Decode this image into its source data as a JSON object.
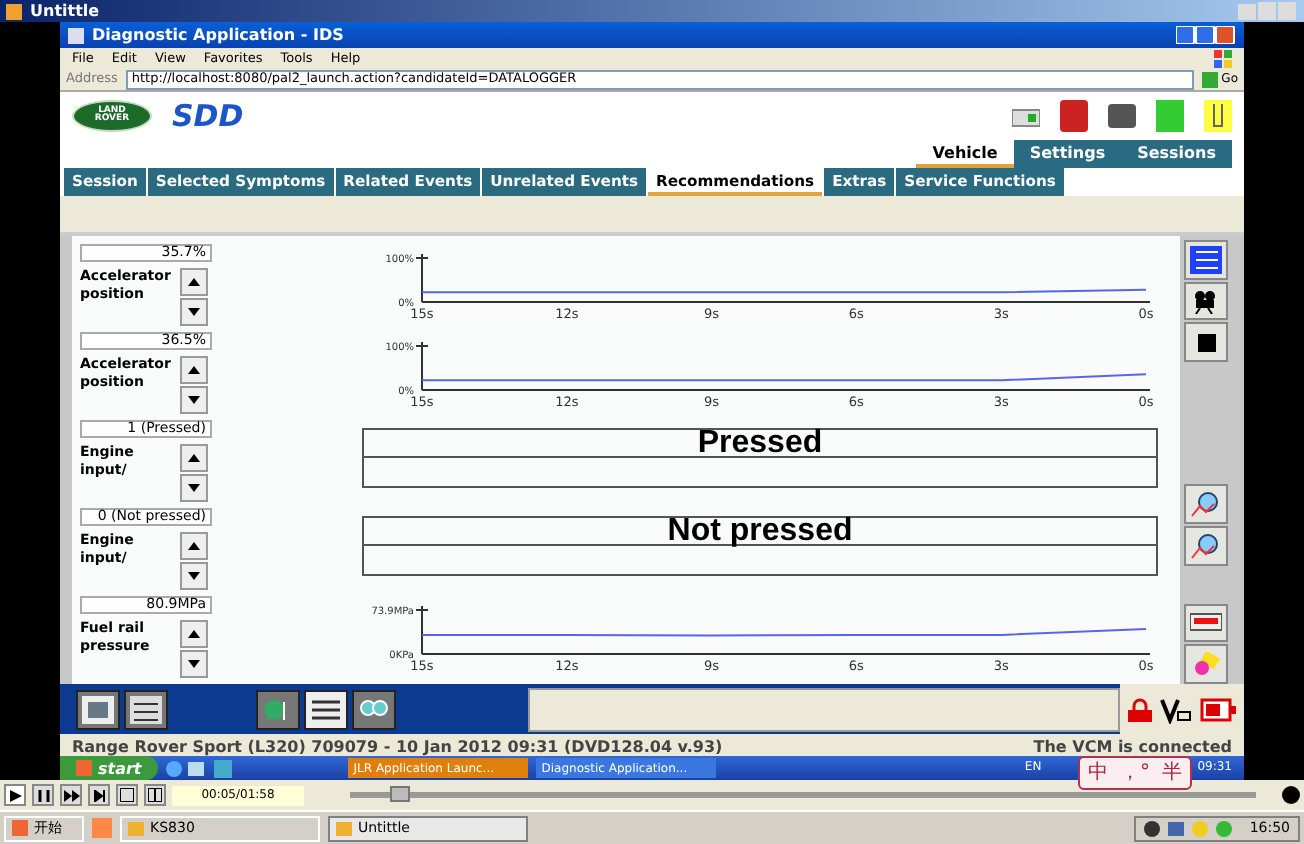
{
  "player_window": {
    "title": "Untittle"
  },
  "browser": {
    "title": "Diagnostic Application - IDS",
    "menu": [
      "File",
      "Edit",
      "View",
      "Favorites",
      "Tools",
      "Help"
    ],
    "address_label": "Address",
    "url": "http://localhost:8080/pal2_launch.action?candidateId=DATALOGGER",
    "go_button": "Go"
  },
  "app": {
    "logo_lines": [
      "LAND",
      "ROVER"
    ],
    "brand": "SDD",
    "top_tabs": [
      {
        "label": "Vehicle",
        "selected": true
      },
      {
        "label": "Settings",
        "selected": false
      },
      {
        "label": "Sessions",
        "selected": false
      }
    ],
    "tabs": [
      {
        "label": "Session",
        "selected": false
      },
      {
        "label": "Selected Symptoms",
        "selected": false
      },
      {
        "label": "Related Events",
        "selected": false
      },
      {
        "label": "Unrelated Events",
        "selected": false
      },
      {
        "label": "Recommendations",
        "selected": true
      },
      {
        "label": "Extras",
        "selected": false
      },
      {
        "label": "Service Functions",
        "selected": false
      }
    ],
    "signals": [
      {
        "kind": "graph",
        "value": "35.7%",
        "name": "Accelerator position",
        "chart_data": {
          "type": "line",
          "categories": [
            "15s",
            "12s",
            "9s",
            "6s",
            "3s",
            "0s"
          ],
          "ylim": [
            0,
            100
          ],
          "yticks": [
            {
              "value": 0,
              "label": "0%"
            },
            {
              "value": 100,
              "label": "100%"
            }
          ],
          "series": [
            {
              "color": "#5566ee",
              "values": [
                22,
                22,
                22,
                22,
                22,
                28
              ]
            }
          ]
        }
      },
      {
        "kind": "graph",
        "value": "36.5%",
        "name": "Accelerator position",
        "chart_data": {
          "type": "line",
          "categories": [
            "15s",
            "12s",
            "9s",
            "6s",
            "3s",
            "0s"
          ],
          "ylim": [
            0,
            100
          ],
          "yticks": [
            {
              "value": 0,
              "label": "0%"
            },
            {
              "value": 100,
              "label": "100%"
            }
          ],
          "series": [
            {
              "color": "#5566ee",
              "values": [
                22,
                22,
                22,
                22,
                22,
                36
              ]
            }
          ]
        }
      },
      {
        "kind": "state",
        "value": "1 (Pressed)",
        "name": "Engine input/",
        "state_text": "Pressed"
      },
      {
        "kind": "state",
        "value": "0 (Not pressed)",
        "name": "Engine input/",
        "state_text": "Not pressed"
      },
      {
        "kind": "graph",
        "value": "80.9MPa",
        "name": "Fuel rail pressure",
        "chart_data": {
          "type": "line",
          "categories": [
            "15s",
            "12s",
            "9s",
            "6s",
            "3s",
            "0s"
          ],
          "ylim": [
            0,
            73.9
          ],
          "yticks": [
            {
              "value": 0,
              "label": "0KPa"
            },
            {
              "value": 73.9,
              "label": "73.9MPa"
            }
          ],
          "series": [
            {
              "color": "#5566ee",
              "values": [
                32,
                32,
                31,
                32,
                32,
                42
              ]
            }
          ]
        }
      }
    ]
  },
  "status": {
    "vehicle": "Range Rover Sport (L320) 709079 - 10 Jan 2012 09:31 (DVD128.04 v.93)",
    "connection": "The VCM is connected"
  },
  "taskbar": {
    "start": "start",
    "tasks": [
      {
        "label": "JLR Application Launc...",
        "selected": true
      },
      {
        "label": "Diagnostic Application...",
        "selected": false
      }
    ],
    "language": "EN",
    "time": "09:31"
  },
  "ime": {
    "chars": [
      "中",
      "，°",
      "半"
    ]
  },
  "player": {
    "time": "00:05/01:58"
  },
  "host_taskbar": {
    "start": "开始",
    "tasks": [
      {
        "label": "KS830",
        "selected": false
      },
      {
        "label": "Untittle",
        "selected": true
      }
    ],
    "time": "16:50"
  }
}
